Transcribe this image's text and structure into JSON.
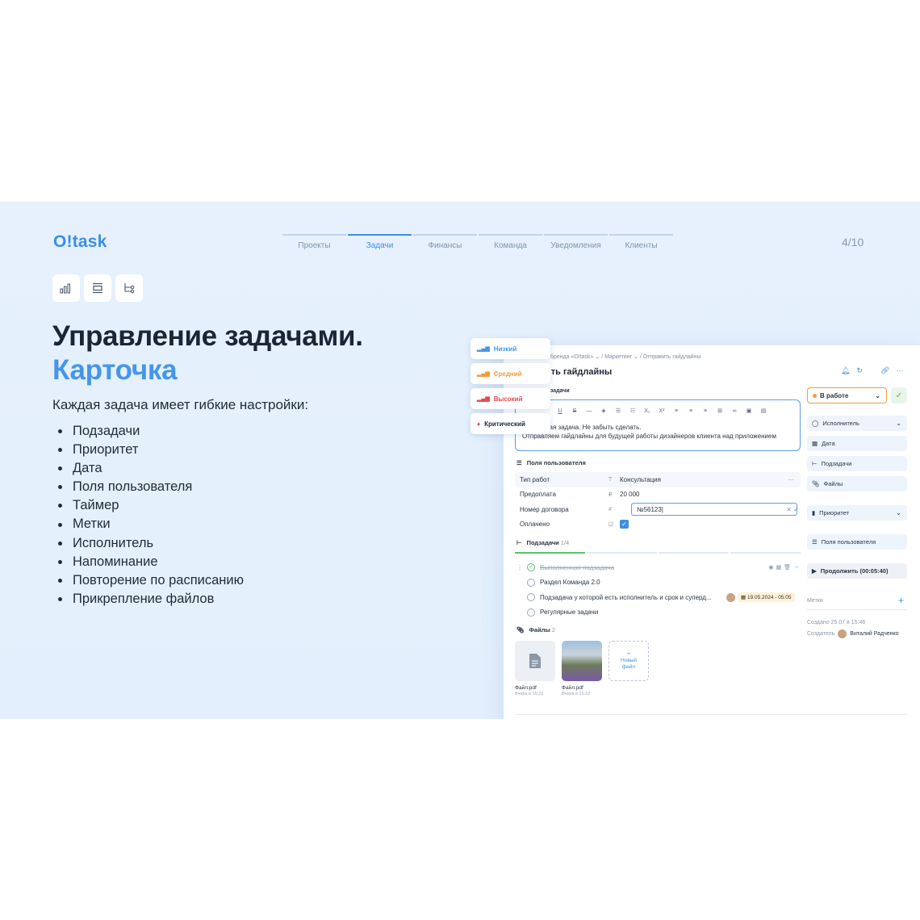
{
  "brand": {
    "logo": "O!task"
  },
  "nav": {
    "items": [
      "Проекты",
      "Задачи",
      "Финансы",
      "Команда",
      "Уведомления",
      "Клиенты"
    ],
    "active": 1
  },
  "pager": "4/10",
  "icons": [
    "bar-chart-icon",
    "align-icon",
    "hierarchy-icon"
  ],
  "heading": {
    "line1": "Управление задачами.",
    "line2": "Карточка"
  },
  "intro": "Каждая задача имеет гибкие настройки:",
  "features": [
    "Подзадачи",
    "Приоритет",
    "Дата",
    "Поля пользователя",
    "Таймер",
    "Метки",
    "Исполнитель",
    "Напоминание",
    "Повторение по расписанию",
    "Прикрепление файлов"
  ],
  "card": {
    "breadcrumb": "е бренда «O!task»  ⌄  /  Маркетинг  ⌄  /  Отправить гайдлайны",
    "title": "ить гайдлайны",
    "desc_label": "е задачи",
    "desc_line1": "Важная задача. Не забыть сделать.",
    "desc_line2": "Отправляем гайдлайны для будущей работы дизайнеров клиента над приложением",
    "user_fields_title": "Поля пользователя",
    "fields": [
      {
        "key": "Тип работ",
        "type": "T",
        "value": "Консультация"
      },
      {
        "key": "Предоплата",
        "type": "₽",
        "value": "20 000"
      },
      {
        "key": "Номер договора",
        "type": "#",
        "value": "№56123|"
      },
      {
        "key": "Оплачено",
        "type": "☑",
        "value": ""
      }
    ],
    "subtasks_title": "Подзадачи",
    "subtasks_count": "1/4",
    "subtasks": [
      "Выполненная подзадача",
      "Раздел Команда 2.0",
      "Подзадача у которой есть исполнитель и срок и суперд...",
      "Регулярные задачи"
    ],
    "subtask_date": "19.05.2024 - 05:05",
    "files_title": "Файлы",
    "files_count": "2",
    "files": [
      {
        "name": "Файл.pdf",
        "meta": "Вчера в 15:22"
      },
      {
        "name": "Файл.pdf",
        "meta": "Вчера в 15:22"
      }
    ],
    "new_file": "+\nНовый\nфайл",
    "status": "В работе",
    "right": {
      "assignee": "Исполнитель",
      "date": "Дата",
      "subtasks": "Подзадачи",
      "files": "Файлы",
      "priority": "Приоритет",
      "user_fields": "Поля пользователя",
      "timer": "Продолжить (00:05:40)",
      "tags": "Метки",
      "created": "Создано 25.07 в 15:46",
      "creator_label": "Создатель",
      "creator": "Виталий Радченко"
    }
  },
  "priority": [
    {
      "label": "Низкий",
      "color": "#4596ea"
    },
    {
      "label": "Средний",
      "color": "#f39a34"
    },
    {
      "label": "Высокий",
      "color": "#e8474f"
    },
    {
      "label": "Критический",
      "color": "#1d2636"
    }
  ]
}
